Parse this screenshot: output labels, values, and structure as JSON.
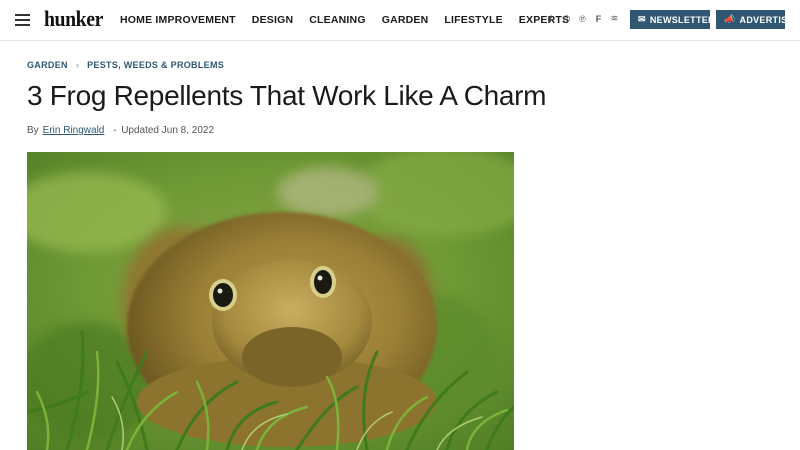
{
  "header": {
    "logo": "hunker",
    "menu_icon": "hamburger-menu-icon",
    "nav": [
      {
        "label": "HOME IMPROVEMENT"
      },
      {
        "label": "DESIGN"
      },
      {
        "label": "CLEANING"
      },
      {
        "label": "GARDEN"
      },
      {
        "label": "LIFESTYLE"
      },
      {
        "label": "EXPERTS"
      }
    ],
    "social": [
      {
        "glyph": "f",
        "icon": "facebook-icon"
      },
      {
        "glyph": "◎",
        "icon": "instagram-icon"
      },
      {
        "glyph": "℗",
        "icon": "pinterest-icon"
      },
      {
        "glyph": "F",
        "icon": "flipboard-icon"
      },
      {
        "glyph": "≋",
        "icon": "rss-icon"
      }
    ],
    "newsletter_label": "NEWSLETTER",
    "newsletter_icon": "✉",
    "advertise_label": "ADVERTISE",
    "advertise_icon": "📣"
  },
  "breadcrumb": {
    "category": "GARDEN",
    "separator": "›",
    "subcategory": "PESTS, WEEDS & PROBLEMS"
  },
  "article": {
    "title": "3 Frog Repellents That Work Like A Charm",
    "by": "By",
    "author": "Erin Ringwald",
    "dot": "•",
    "updated": "Updated Jun 8, 2022"
  },
  "colors": {
    "brand": "#2f5772",
    "text": "#1a1a1a"
  }
}
